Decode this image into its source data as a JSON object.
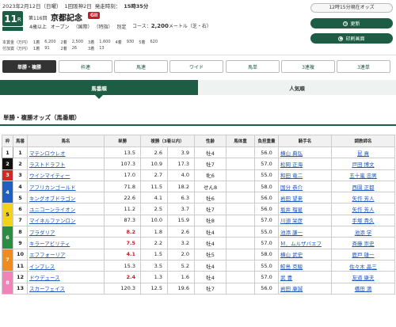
{
  "header": {
    "date": "2023年2月12日（日曜）",
    "meeting": "1回阪神2日",
    "start_label": "発走時刻：",
    "start_time": "15時35分",
    "race_number": "11",
    "race_number_suffix": "R",
    "race_count": "第116回",
    "race_name": "京都記念",
    "grade": "GII",
    "condition_age": "4歳以上",
    "condition_class": "オープン",
    "condition_type": "（国際）",
    "condition_extra": "（特指）",
    "condition_weight": "別定",
    "course_label": "コース：",
    "course_distance": "2,200",
    "course_unit": "メートル",
    "course_surface": "（芝・右）"
  },
  "side": {
    "updated": "12時15分現在オッズ",
    "update_label": "更新",
    "print_label": "印刷画面"
  },
  "prizes": {
    "rows": [
      {
        "label": "本賞金（万円）",
        "values": [
          "1着",
          "6,200",
          "2着",
          "2,500",
          "3着",
          "1,600",
          "4着",
          "930",
          "5着",
          "620"
        ]
      },
      {
        "label": "付加賞（万円）",
        "values": [
          "1着",
          "91",
          "2着",
          "26",
          "3着",
          "13",
          "",
          "",
          "",
          ""
        ]
      }
    ]
  },
  "tabs": [
    {
      "label": "単勝・複勝",
      "active": true
    },
    {
      "label": "枠連",
      "active": false
    },
    {
      "label": "馬連",
      "active": false
    },
    {
      "label": "ワイド",
      "active": false
    },
    {
      "label": "馬単",
      "active": false
    },
    {
      "label": "3連複",
      "active": false
    },
    {
      "label": "3連単",
      "active": false
    }
  ],
  "subtabs": {
    "left": "馬番順",
    "right": "人気順"
  },
  "section_title": "単勝・複勝オッズ（馬番順）",
  "table": {
    "headers": [
      "枠",
      "馬番",
      "馬名",
      "単勝",
      "複勝（3着以内）",
      "性齢",
      "馬体重",
      "負担重量",
      "騎手名",
      "調教師名"
    ],
    "frame_colors": {
      "1": "#ffffff",
      "2": "#111111",
      "3": "#d7261e",
      "4": "#1e5fbf",
      "5": "#f2d21c",
      "6": "#2c8c3f",
      "7": "#f08c1e",
      "8": "#f283b8"
    },
    "rows": [
      {
        "frame": "1",
        "num": "1",
        "name": "マテンロウレオ",
        "win": "13.5",
        "pmin": "2.6",
        "pmax": "3.9",
        "sex": "牡4",
        "body": "",
        "wt": "56.0",
        "jockey": "横山 典弘",
        "trainer": "昆 貢",
        "hot": false
      },
      {
        "frame": "2",
        "num": "2",
        "name": "ラストドラフト",
        "win": "107.3",
        "pmin": "10.9",
        "pmax": "17.3",
        "sex": "牡7",
        "body": "",
        "wt": "57.0",
        "jockey": "松岡 正海",
        "trainer": "戸田 博文",
        "hot": false
      },
      {
        "frame": "3",
        "num": "3",
        "name": "ウインマイティー",
        "win": "17.0",
        "pmin": "2.7",
        "pmax": "4.0",
        "sex": "牝6",
        "body": "",
        "wt": "55.0",
        "jockey": "和田 竜二",
        "trainer": "五十嵐 忠男",
        "hot": false
      },
      {
        "frame": "4",
        "num": "4",
        "name": "アフリカンゴールド",
        "win": "71.8",
        "pmin": "11.5",
        "pmax": "18.2",
        "sex": "せん8",
        "body": "",
        "wt": "58.0",
        "jockey": "国分 恭介",
        "trainer": "西園 正都",
        "hot": false
      },
      {
        "frame": "4",
        "num": "5",
        "name": "キングオブドラゴン",
        "win": "22.6",
        "pmin": "4.1",
        "pmax": "6.3",
        "sex": "牡6",
        "body": "",
        "wt": "56.0",
        "jockey": "岩田 望来",
        "trainer": "矢作 芳人",
        "hot": false
      },
      {
        "frame": "5",
        "num": "6",
        "name": "ユニコーンライオン",
        "win": "11.2",
        "pmin": "2.5",
        "pmax": "3.7",
        "sex": "牡7",
        "body": "",
        "wt": "56.0",
        "jockey": "坂井 瑠星",
        "trainer": "矢作 芳人",
        "hot": false
      },
      {
        "frame": "5",
        "num": "7",
        "name": "マイネルファンロン",
        "win": "87.3",
        "pmin": "10.0",
        "pmax": "15.9",
        "sex": "牡8",
        "body": "",
        "wt": "57.0",
        "jockey": "川須 栄彦",
        "trainer": "手塚 貴久",
        "hot": false
      },
      {
        "frame": "6",
        "num": "8",
        "name": "プラダリア",
        "win": "8.2",
        "pmin": "1.8",
        "pmax": "2.6",
        "sex": "牡4",
        "body": "",
        "wt": "55.0",
        "jockey": "池添 謙一",
        "trainer": "池添 学",
        "hot": true
      },
      {
        "frame": "6",
        "num": "9",
        "name": "キラーアビリティ",
        "win": "7.5",
        "pmin": "2.2",
        "pmax": "3.2",
        "sex": "牡4",
        "body": "",
        "wt": "57.0",
        "jockey": "Ｍ．ムルザバエフ",
        "trainer": "斉藤 崇史",
        "hot": true
      },
      {
        "frame": "7",
        "num": "10",
        "name": "エフフォーリア",
        "win": "4.1",
        "pmin": "1.5",
        "pmax": "2.0",
        "sex": "牡5",
        "body": "",
        "wt": "58.0",
        "jockey": "横山 武史",
        "trainer": "鹿戸 雄一",
        "hot": true
      },
      {
        "frame": "7",
        "num": "11",
        "name": "インプレス",
        "win": "15.3",
        "pmin": "3.5",
        "pmax": "5.2",
        "sex": "牡4",
        "body": "",
        "wt": "55.0",
        "jockey": "鮫島 克駿",
        "trainer": "佐々木 晶三",
        "hot": false
      },
      {
        "frame": "8",
        "num": "12",
        "name": "ドウデュース",
        "win": "2.4",
        "pmin": "1.3",
        "pmax": "1.6",
        "sex": "牡4",
        "body": "",
        "wt": "57.0",
        "jockey": "武 豊",
        "trainer": "友道 康夫",
        "hot": true
      },
      {
        "frame": "8",
        "num": "13",
        "name": "スカーフェイス",
        "win": "120.3",
        "pmin": "12.5",
        "pmax": "19.6",
        "sex": "牡7",
        "body": "",
        "wt": "56.0",
        "jockey": "岩田 康誠",
        "trainer": "橋田 満",
        "hot": false
      }
    ]
  }
}
